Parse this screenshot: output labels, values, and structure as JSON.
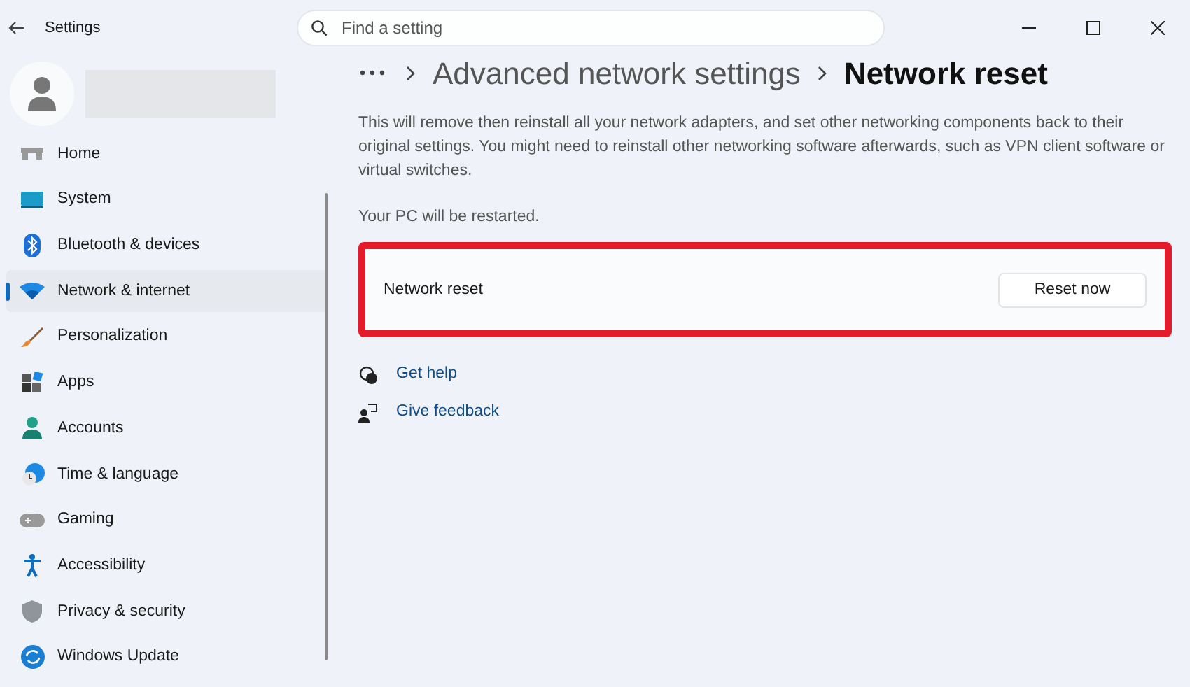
{
  "window": {
    "title": "Settings"
  },
  "search": {
    "placeholder": "Find a setting"
  },
  "sidebar": {
    "items": [
      {
        "label": "Home",
        "selected": false
      },
      {
        "label": "System",
        "selected": false
      },
      {
        "label": "Bluetooth & devices",
        "selected": false
      },
      {
        "label": "Network & internet",
        "selected": true
      },
      {
        "label": "Personalization",
        "selected": false
      },
      {
        "label": "Apps",
        "selected": false
      },
      {
        "label": "Accounts",
        "selected": false
      },
      {
        "label": "Time & language",
        "selected": false
      },
      {
        "label": "Gaming",
        "selected": false
      },
      {
        "label": "Accessibility",
        "selected": false
      },
      {
        "label": "Privacy & security",
        "selected": false
      },
      {
        "label": "Windows Update",
        "selected": false
      }
    ]
  },
  "breadcrumb": [
    "Advanced network settings",
    "Network reset"
  ],
  "description": "This will remove then reinstall all your network adapters, and set other networking components back to their original settings. You might need to reinstall other networking software afterwards, such as VPN client software or virtual switches.",
  "note": "Your PC will be restarted.",
  "card": {
    "label": "Network reset",
    "button": "Reset now",
    "highlighted": true
  },
  "links": [
    "Get help",
    "Give feedback"
  ]
}
